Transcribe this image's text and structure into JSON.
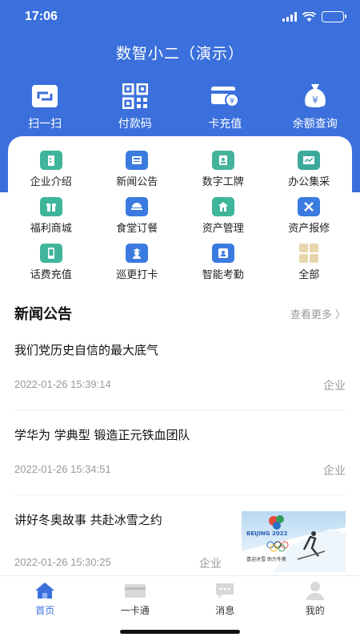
{
  "status_bar": {
    "time": "17:06"
  },
  "app": {
    "title": "数智小二（演示）"
  },
  "quick_actions": [
    {
      "label": "扫一扫",
      "icon": "scan-icon"
    },
    {
      "label": "付款码",
      "icon": "qr-code-icon"
    },
    {
      "label": "卡充值",
      "icon": "card-recharge-icon"
    },
    {
      "label": "余额查询",
      "icon": "balance-bag-icon"
    }
  ],
  "services": [
    {
      "label": "企业介绍",
      "icon": "building-icon",
      "color": "#3fb59b"
    },
    {
      "label": "新闻公告",
      "icon": "news-icon",
      "color": "#3b7be0"
    },
    {
      "label": "数字工牌",
      "icon": "badge-icon",
      "color": "#45b39c"
    },
    {
      "label": "办公集采",
      "icon": "office-purchase-icon",
      "color": "#3ba89a"
    },
    {
      "label": "福利商城",
      "icon": "gift-icon",
      "color": "#3fb59b"
    },
    {
      "label": "食堂订餐",
      "icon": "meal-icon",
      "color": "#3b7be0"
    },
    {
      "label": "资产管理",
      "icon": "asset-house-icon",
      "color": "#3fb59b"
    },
    {
      "label": "资产报修",
      "icon": "repair-tools-icon",
      "color": "#3b7be0"
    },
    {
      "label": "话费充值",
      "icon": "phone-recharge-icon",
      "color": "#3fb59b"
    },
    {
      "label": "巡更打卡",
      "icon": "patrol-guard-icon",
      "color": "#3b7be0"
    },
    {
      "label": "智能考勤",
      "icon": "attendance-icon",
      "color": "#3b7be0"
    },
    {
      "label": "全部",
      "icon": "all-apps-icon",
      "color": "#e8d7ad"
    }
  ],
  "news": {
    "title": "新闻公告",
    "more": "查看更多 〉",
    "items": [
      {
        "title": "我们党历史自信的最大底气",
        "date": "2022-01-26 15:39:14",
        "category": "企业"
      },
      {
        "title": "学华为 学典型 锻造正元铁血团队",
        "date": "2022-01-26 15:34:51",
        "category": "企业"
      },
      {
        "title": "讲好冬奥故事 共赴冰雪之约",
        "date": "2022-01-26 15:30:25",
        "category": "企业",
        "image_text": {
          "event": "BEIJING 2022",
          "caption": "喜迎冰雪   助力冬奥"
        }
      }
    ]
  },
  "tabbar": [
    {
      "label": "首页",
      "icon": "home-icon",
      "active": true
    },
    {
      "label": "一卡通",
      "icon": "card-icon",
      "active": false
    },
    {
      "label": "消息",
      "icon": "message-icon",
      "active": false
    },
    {
      "label": "我的",
      "icon": "user-icon",
      "active": false
    }
  ],
  "colors": {
    "brand_blue": "#3b70dc",
    "muted_text": "#999999",
    "divider": "#eeeeee"
  }
}
